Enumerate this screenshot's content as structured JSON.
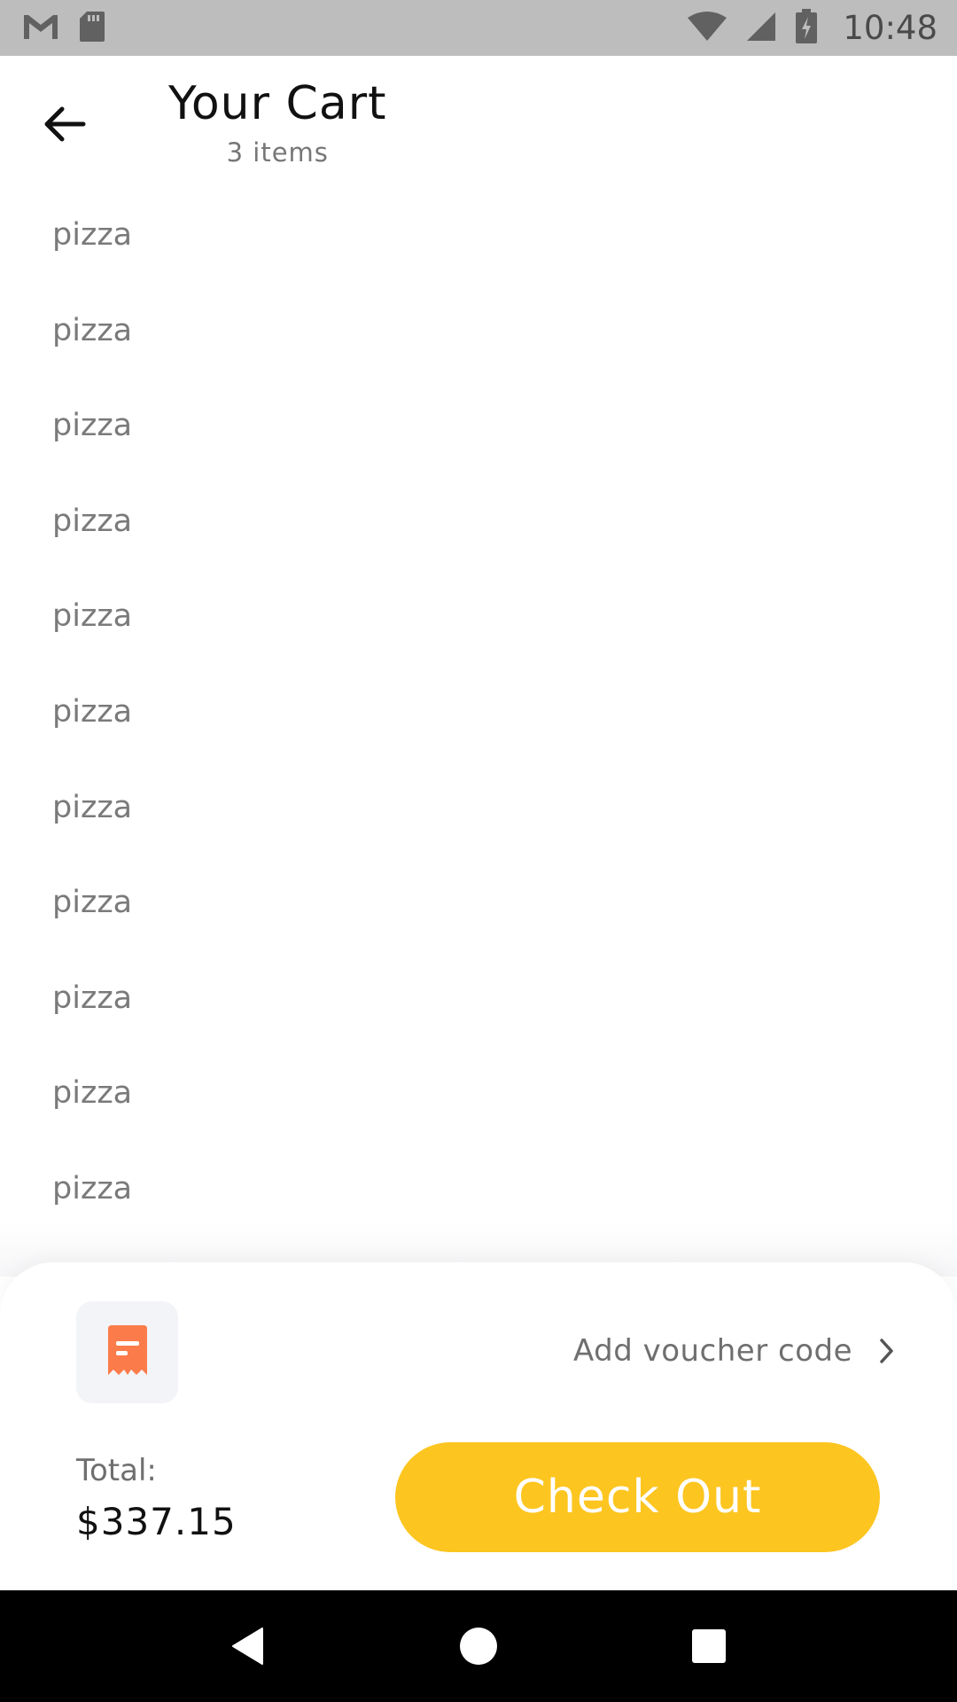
{
  "status_bar": {
    "time": "10:48",
    "icons": [
      "gmail-icon",
      "sd-card-icon",
      "wifi-icon",
      "signal-icon",
      "battery-charging-icon"
    ]
  },
  "header": {
    "title": "Your Cart",
    "subtitle": "3 items"
  },
  "cart_items": [
    {
      "label": "pizza"
    },
    {
      "label": "pizza"
    },
    {
      "label": "pizza"
    },
    {
      "label": "pizza"
    },
    {
      "label": "pizza"
    },
    {
      "label": "pizza"
    },
    {
      "label": "pizza"
    },
    {
      "label": "pizza"
    },
    {
      "label": "pizza"
    },
    {
      "label": "pizza"
    },
    {
      "label": "pizza"
    }
  ],
  "voucher": {
    "label": "Add voucher code",
    "icon": "receipt-icon",
    "accent_color": "#fb7c4a"
  },
  "summary": {
    "total_label": "Total:",
    "total_value": "$337.15"
  },
  "checkout": {
    "label": "Check Out",
    "color": "#fdc520"
  },
  "nav_bar": {
    "buttons": [
      "back-nav-icon",
      "home-nav-icon",
      "recents-nav-icon"
    ]
  }
}
